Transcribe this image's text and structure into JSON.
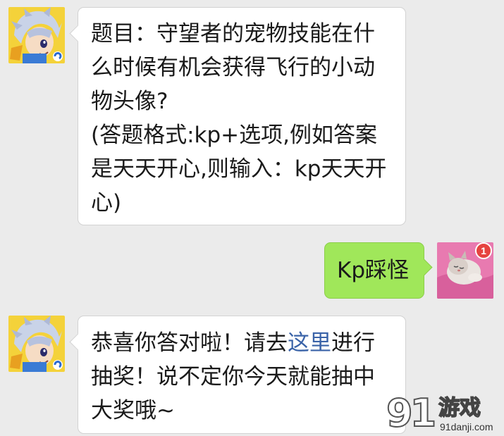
{
  "messages": [
    {
      "sender": "bot",
      "avatar_icon": "anime-character-avatar-icon",
      "lines": [
        "题目：守望者的宠物技能在什",
        "么时候有机会获得飞行的小动",
        "物头像?",
        "(答题格式:kp+选项,例如答案",
        "是天天开心,则输入：kp天天开",
        "心)"
      ]
    },
    {
      "sender": "me",
      "avatar_icon": "kitten-avatar-icon",
      "text": "Kp踩怪",
      "badge": "1"
    },
    {
      "sender": "bot",
      "avatar_icon": "anime-character-avatar-icon",
      "line1_before": "恭喜你答对啦！请去",
      "line1_link": "这里",
      "line1_after": "进行",
      "line2": "抽奖！说不定你今天就能抽中",
      "line3": "大奖哦~"
    }
  ],
  "watermark": {
    "logo_number": "91",
    "brand": "游戏",
    "url": "91danji.com"
  },
  "colors": {
    "background": "#ebebeb",
    "incoming_bubble": "#ffffff",
    "outgoing_bubble": "#a0e75a",
    "link": "#3a63a8",
    "badge": "#e64340"
  }
}
